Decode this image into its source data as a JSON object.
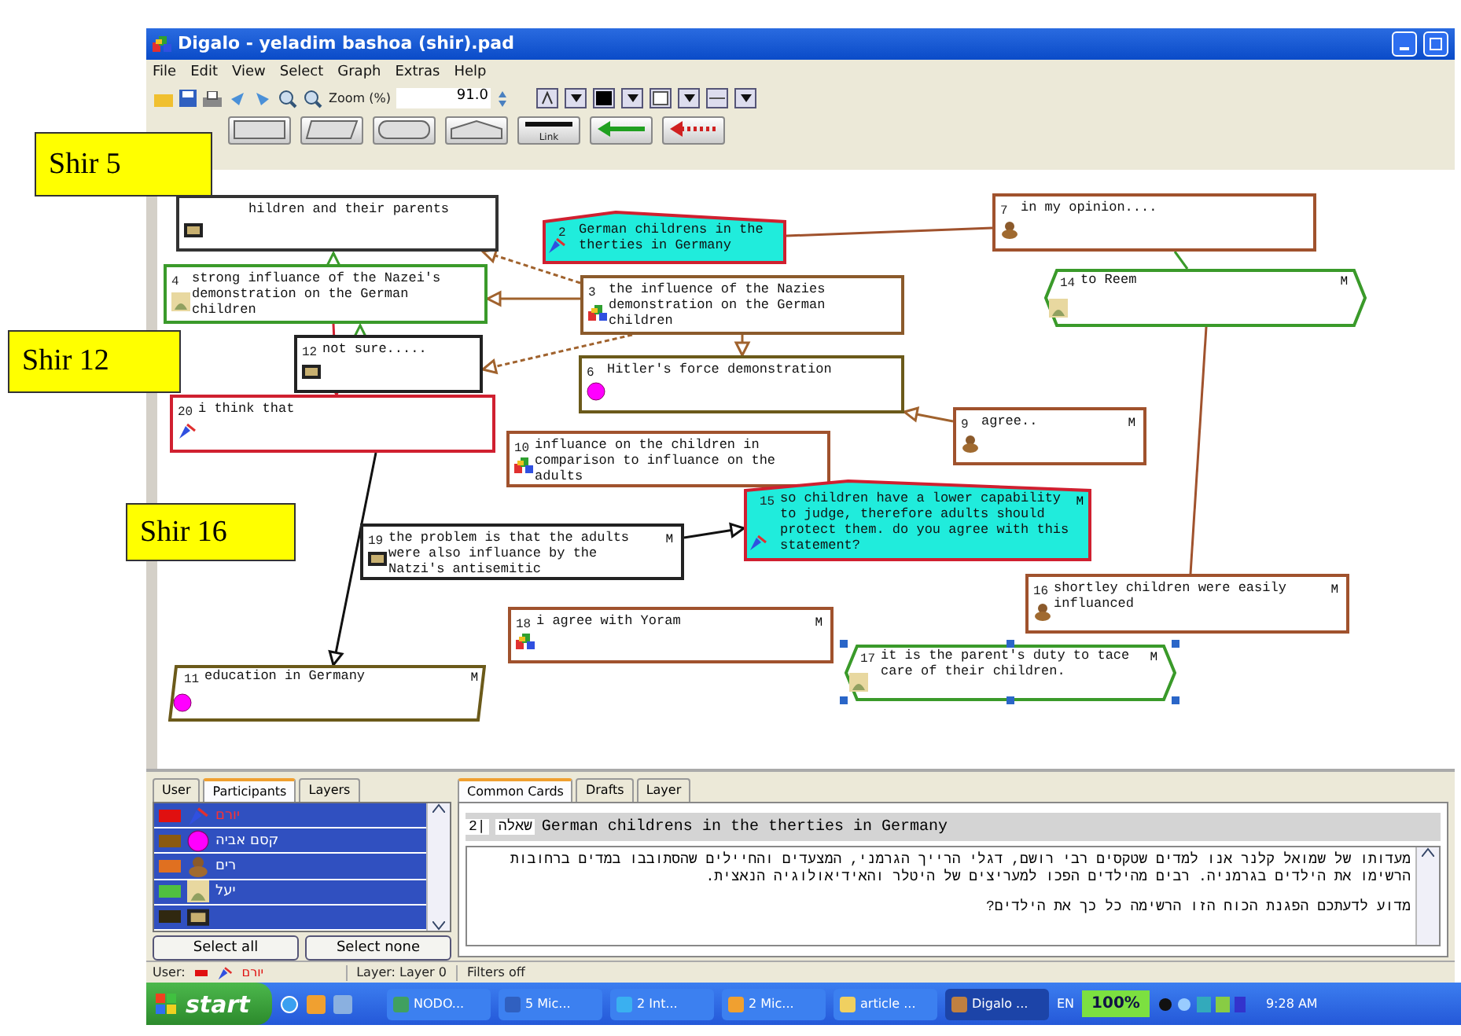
{
  "window": {
    "title": "Digalo - yeladim bashoa (shir).pad"
  },
  "menu": [
    "File",
    "Edit",
    "View",
    "Select",
    "Graph",
    "Extras",
    "Help"
  ],
  "toolbar": {
    "zoom_label": "Zoom (%)",
    "zoom_value": "91.0"
  },
  "shapes": [
    {
      "kind": "rect"
    },
    {
      "kind": "parallelogram"
    },
    {
      "kind": "rounded"
    },
    {
      "kind": "roof"
    },
    {
      "kind": "line",
      "label": "Link"
    },
    {
      "kind": "arrow"
    },
    {
      "kind": "dashed-arrow"
    }
  ],
  "callouts": [
    "Shir 5",
    "Shir 12",
    "Shir 16"
  ],
  "nodes": [
    {
      "kind": "rect",
      "text": "hildren and their parents",
      "color": "#333333",
      "selected": false
    },
    {
      "kind": "question",
      "number": "2",
      "text": "German childrens in the therties in Germany",
      "color": "#d02030",
      "selected": false
    },
    {
      "kind": "rect",
      "number": "7",
      "text": "in my opinion....",
      "color": "#a0522d",
      "selected": false
    },
    {
      "kind": "rect",
      "number": "4",
      "text": "strong influance of the Nazei's demonstration on the German children",
      "color": "#3a9a2a",
      "selected": false
    },
    {
      "kind": "rect",
      "number": "3",
      "text": "the influence of the Nazies demonstration on the German children",
      "color": "#8b5a2b",
      "selected": false
    },
    {
      "kind": "hexagon",
      "number": "14",
      "text": "to Reem",
      "flag": "M",
      "color": "#3a9a2a",
      "selected": false
    },
    {
      "kind": "rect",
      "number": "12",
      "text": "not sure.....",
      "color": "#222222",
      "selected": false
    },
    {
      "kind": "rect",
      "number": "6",
      "text": "Hitler's force demonstration",
      "color": "#6b5a1a",
      "selected": false
    },
    {
      "kind": "rect",
      "number": "20",
      "text": "i think that",
      "color": "#d02030",
      "selected": false
    },
    {
      "kind": "rect",
      "number": "9",
      "text": "agree..",
      "flag": "M",
      "color": "#a0522d",
      "selected": false
    },
    {
      "kind": "rect",
      "number": "10",
      "text": "influance on the children in comparison to influance on the adults",
      "color": "#a0522d",
      "selected": false
    },
    {
      "kind": "question",
      "number": "15",
      "text": "so children have a lower capability to judge, therefore adults should protect them. do you agree with this statement?",
      "flag": "M",
      "color": "#d02030",
      "selected": false
    },
    {
      "kind": "rect",
      "number": "19",
      "text": "the problem is that the adults were also influance by the Natzi's antisemitic",
      "flag": "M",
      "color": "#222222",
      "selected": false
    },
    {
      "kind": "rect",
      "number": "16",
      "text": "shortley children were easily influanced",
      "flag": "M",
      "color": "#a0522d",
      "selected": false
    },
    {
      "kind": "rect",
      "number": "18",
      "text": "i agree with Yoram",
      "flag": "M",
      "color": "#a0522d",
      "selected": false
    },
    {
      "kind": "hexagon",
      "number": "17",
      "text": "it is the parent's duty to tace care of their children.",
      "flag": "M",
      "color": "#3a9a2a",
      "selected": true
    },
    {
      "kind": "parallelogram",
      "number": "11",
      "text": "education in Germany",
      "flag": "M",
      "color": "#6b5a1a",
      "selected": false
    }
  ],
  "left_tabs": [
    {
      "label": "User",
      "selected": false
    },
    {
      "label": "Participants",
      "selected": true
    },
    {
      "label": "Layers",
      "selected": false
    }
  ],
  "participants": [
    {
      "name": "יורם",
      "color": "#e01010",
      "selected": true
    },
    {
      "name": "קסם אביה",
      "color": "#8b5a10",
      "selected": true
    },
    {
      "name": "רים",
      "color": "#e07020",
      "selected": true
    },
    {
      "name": "יעל",
      "color": "#50c040",
      "selected": true
    },
    {
      "color": "#302810",
      "selected": true
    }
  ],
  "participant_buttons": [
    "Select all",
    "Select none"
  ],
  "right_tabs": [
    {
      "label": "Common Cards",
      "selected": true
    },
    {
      "label": "Drafts",
      "selected": false
    },
    {
      "label": "Layer",
      "selected": false
    }
  ],
  "card": {
    "number": "2|",
    "type": "שאלה",
    "title": "German childrens in the therties in Germany",
    "body": [
      "מעדותו של שמואל קלנר אנו למדים שטקסים רבי רושם, דגלי הרייך הגרמני, המצעדים והחיילים שהסתובבו במדים ברחובות הרשימו את הילדים בגרמניה. רבים מהילדים הפכו למעריצים של היטלר והאידיאולוגיה הנאצית.",
      "מדוע לדעתכם הפגנת הכוח הזו הרשימה כל כך את הילדים?"
    ]
  },
  "status_bar": {
    "user_label": "User:",
    "user_name": "יורם",
    "layer": "Layer: Layer 0",
    "filters": "Filters off"
  },
  "taskbar": {
    "start": "start",
    "buttons": [
      {
        "label": "NODO...",
        "selected": false
      },
      {
        "label": "5 Mic...",
        "selected": false
      },
      {
        "label": "2 Int...",
        "selected": false
      },
      {
        "label": "2 Mic...",
        "selected": false
      },
      {
        "label": "article ...",
        "selected": false
      },
      {
        "label": "Digalo ...",
        "selected": true
      }
    ],
    "language": "EN",
    "battery": "100%",
    "time": "9:28 AM"
  }
}
